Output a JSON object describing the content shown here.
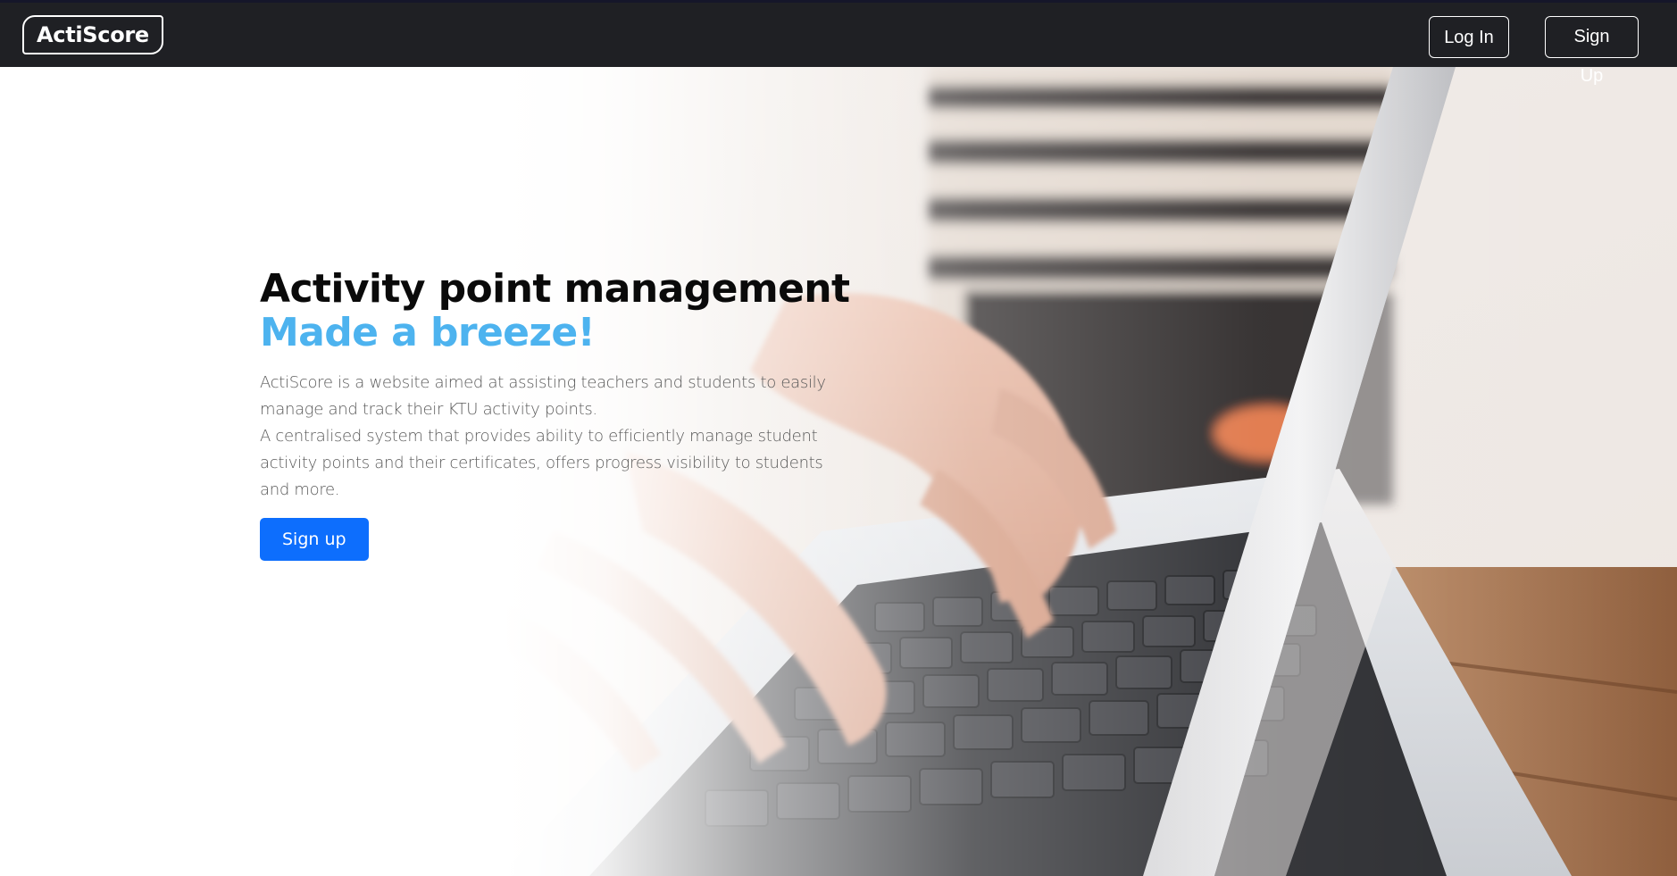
{
  "navbar": {
    "brand": "ActiScore",
    "login_label": "Log In",
    "signup_label": "Sign Up"
  },
  "hero": {
    "title": "Activity point management",
    "subtitle": "Made a breeze!",
    "description_1": "ActiScore is a website aimed at assisting teachers and students to easily manage and track their KTU activity points.",
    "description_2": "A centralised system that provides ability to efficiently manage student activity points and their certificates, offers progress visibility to students and more.",
    "cta_label": "Sign up"
  },
  "colors": {
    "navbar_bg": "#1f2024",
    "accent": "#4db3ef",
    "primary_button": "#0d6efd"
  },
  "icons": {
    "hero_image": "laptop-typing-photo"
  }
}
